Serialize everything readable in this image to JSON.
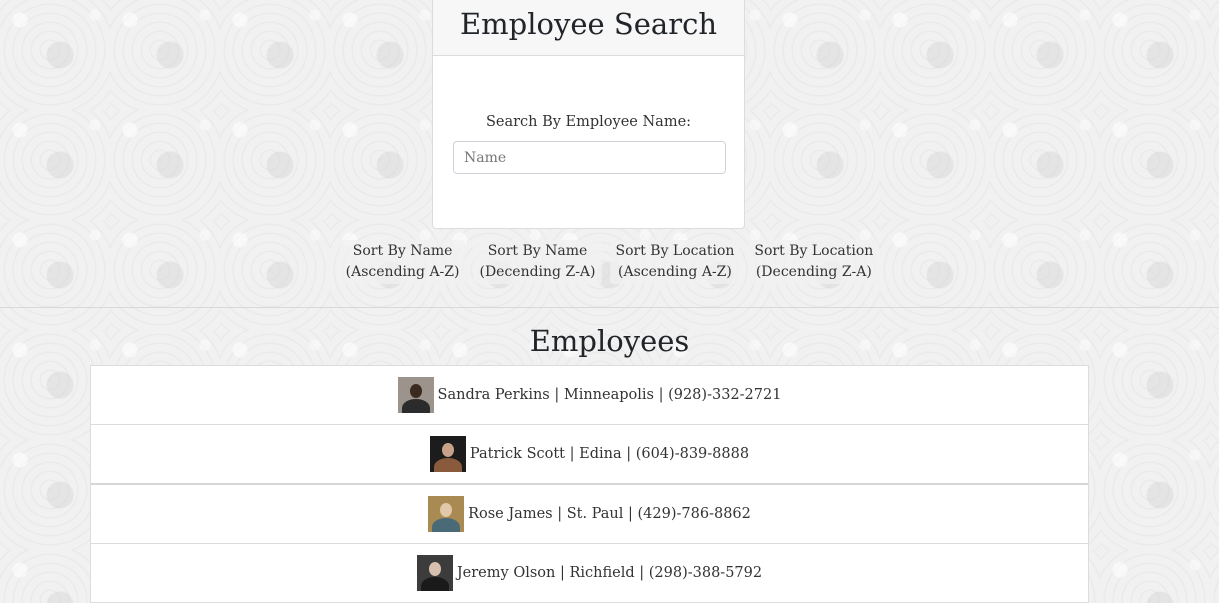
{
  "search": {
    "title": "Employee Search",
    "label": "Search By Employee Name:",
    "placeholder": "Name"
  },
  "sort_buttons": [
    {
      "line1": "Sort By Name",
      "line2": "(Ascending A-Z)"
    },
    {
      "line1": "Sort By Name",
      "line2": "(Decending Z-A)"
    },
    {
      "line1": "Sort By Location",
      "line2": "(Ascending A-Z)"
    },
    {
      "line1": "Sort By Location",
      "line2": "(Decending Z-A)"
    }
  ],
  "employees_title": "Employees",
  "employees": [
    {
      "text": "Sandra Perkins | Minneapolis | (928)-332-2721",
      "avatar": {
        "bg": "#9c948c",
        "hair": "#3a2a20",
        "clothing": "#2b2b2b"
      }
    },
    {
      "text": "Patrick Scott | Edina | (604)-839-8888",
      "avatar": {
        "bg": "#1c1c1c",
        "hair": "#c9a08a",
        "clothing": "#8a5a3c"
      }
    },
    {
      "text": "Rose James | St. Paul | (429)-786-8862",
      "avatar": {
        "bg": "#a88a52",
        "hair": "#e0c8a8",
        "clothing": "#4a6a78"
      }
    },
    {
      "text": "Jeremy Olson | Richfield | (298)-388-5792",
      "avatar": {
        "bg": "#3c3c3c",
        "hair": "#d8c0b0",
        "clothing": "#1a1a1a"
      }
    }
  ]
}
